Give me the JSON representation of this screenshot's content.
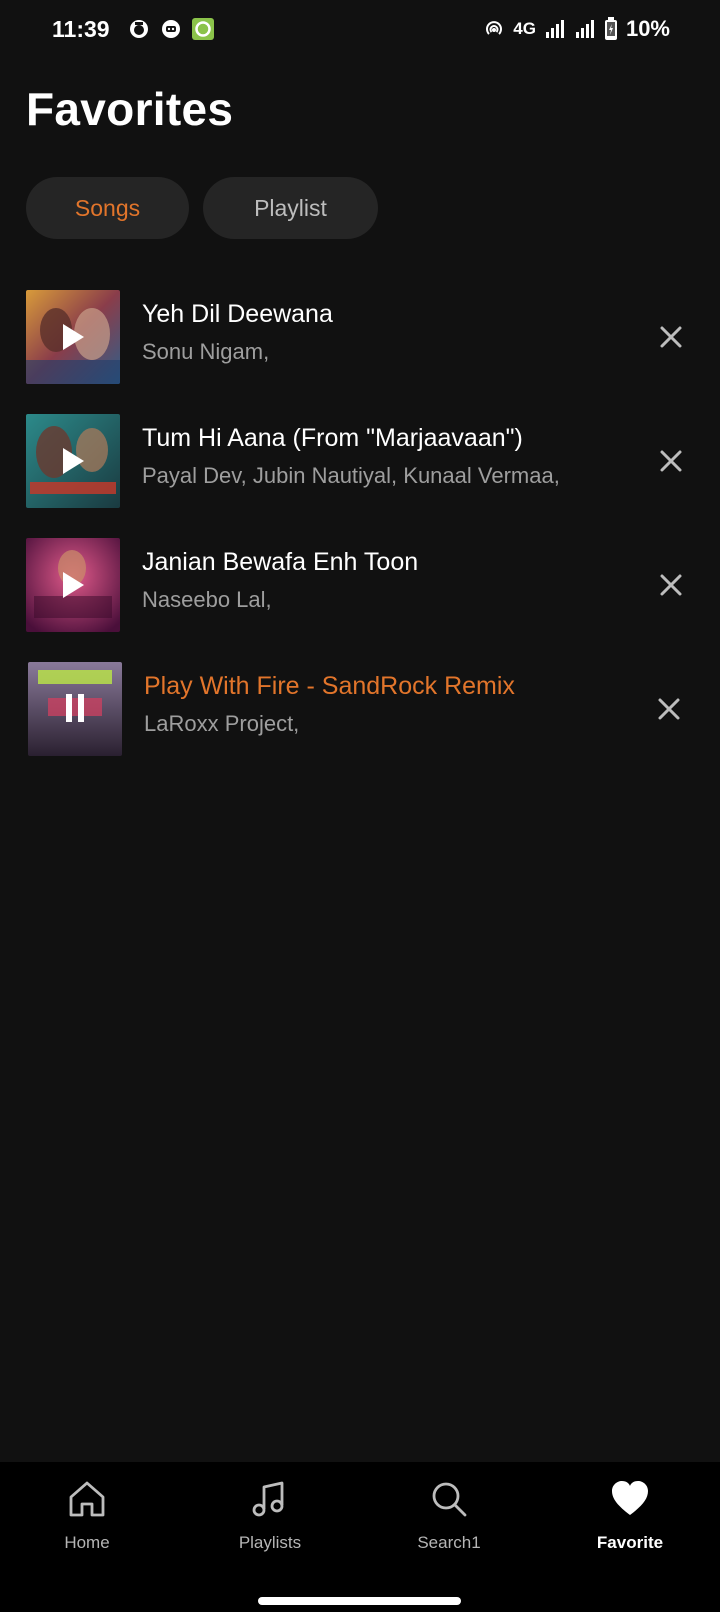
{
  "status_bar": {
    "time": "11:39",
    "network": "4G",
    "battery": "10%",
    "icons": [
      "notification-app-icon",
      "notification-app-icon",
      "notification-app-icon",
      "hotspot-icon",
      "signal-icon",
      "signal-icon",
      "battery-icon"
    ]
  },
  "page": {
    "title": "Favorites"
  },
  "tabs": [
    {
      "label": "Songs",
      "selected": true
    },
    {
      "label": "Playlist",
      "selected": false
    }
  ],
  "songs": [
    {
      "title": "Yeh Dil Deewana",
      "artist": "Sonu Nigam,",
      "playing": false,
      "thumb_state": "play"
    },
    {
      "title": "Tum Hi Aana (From \"Marjaavaan\")",
      "artist": "Payal Dev, Jubin Nautiyal, Kunaal Vermaa,",
      "playing": false,
      "thumb_state": "play"
    },
    {
      "title": "Janian Bewafa Enh Toon",
      "artist": "Naseebo Lal,",
      "playing": false,
      "thumb_state": "play"
    },
    {
      "title": "Play With Fire - SandRock Remix",
      "artist": "LaRoxx Project,",
      "playing": true,
      "thumb_state": "pause"
    }
  ],
  "nav": [
    {
      "label": "Home",
      "icon": "home-icon",
      "active": false
    },
    {
      "label": "Playlists",
      "icon": "music-note-icon",
      "active": false
    },
    {
      "label": "Search1",
      "icon": "search-icon",
      "active": false
    },
    {
      "label": "Favorite",
      "icon": "heart-icon",
      "active": true
    }
  ],
  "colors": {
    "background": "#111111",
    "accent": "#e2752b",
    "tab_background": "#252525",
    "secondary_text": "#9e9e9e",
    "nav_background": "#000000"
  }
}
